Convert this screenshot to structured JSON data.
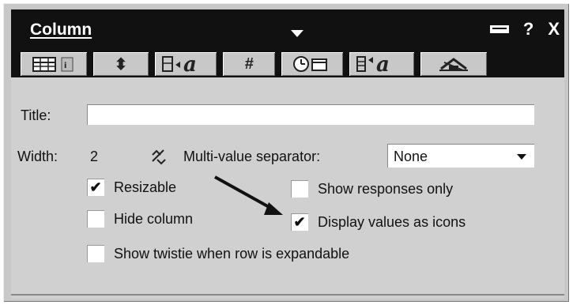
{
  "window": {
    "title": "Column",
    "controls": {
      "help": "?",
      "close": "X"
    }
  },
  "tabs": [
    {
      "name": "column-info",
      "glyph": ""
    },
    {
      "name": "sorting",
      "glyph": "⬍"
    },
    {
      "name": "font",
      "glyph": "a"
    },
    {
      "name": "number",
      "glyph": "#"
    },
    {
      "name": "date-time",
      "glyph": ""
    },
    {
      "name": "title-font",
      "glyph": "a"
    },
    {
      "name": "advanced",
      "glyph": ""
    }
  ],
  "form": {
    "title_label": "Title:",
    "title_value": "",
    "width_label": "Width:",
    "width_value": "2",
    "multi_label": "Multi-value separator:",
    "multi_value": "None",
    "resizable": {
      "label": "Resizable",
      "checked": true
    },
    "hide_column": {
      "label": "Hide column",
      "checked": false
    },
    "show_twistie": {
      "label": "Show twistie when row is expandable",
      "checked": false
    },
    "show_responses": {
      "label": "Show responses only",
      "checked": false
    },
    "display_icons": {
      "label": "Display values as icons",
      "checked": true
    }
  }
}
